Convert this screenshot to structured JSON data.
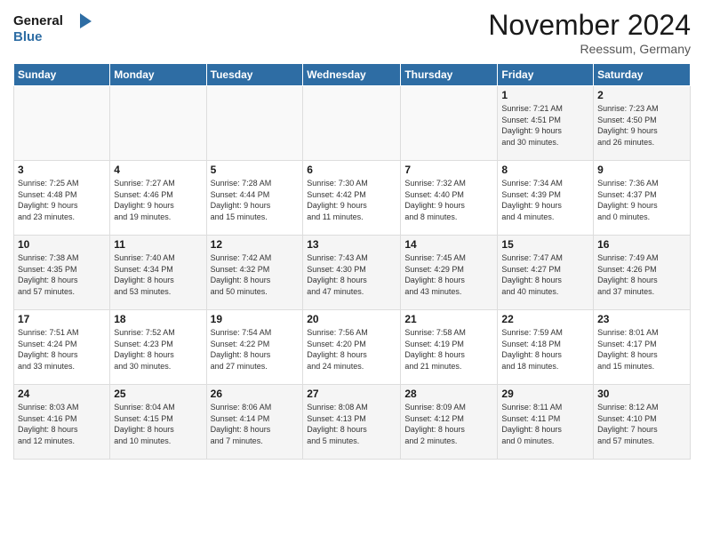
{
  "logo": {
    "line1": "General",
    "line2": "Blue"
  },
  "title": "November 2024",
  "location": "Reessum, Germany",
  "headers": [
    "Sunday",
    "Monday",
    "Tuesday",
    "Wednesday",
    "Thursday",
    "Friday",
    "Saturday"
  ],
  "weeks": [
    [
      {
        "day": "",
        "info": ""
      },
      {
        "day": "",
        "info": ""
      },
      {
        "day": "",
        "info": ""
      },
      {
        "day": "",
        "info": ""
      },
      {
        "day": "",
        "info": ""
      },
      {
        "day": "1",
        "info": "Sunrise: 7:21 AM\nSunset: 4:51 PM\nDaylight: 9 hours\nand 30 minutes."
      },
      {
        "day": "2",
        "info": "Sunrise: 7:23 AM\nSunset: 4:50 PM\nDaylight: 9 hours\nand 26 minutes."
      }
    ],
    [
      {
        "day": "3",
        "info": "Sunrise: 7:25 AM\nSunset: 4:48 PM\nDaylight: 9 hours\nand 23 minutes."
      },
      {
        "day": "4",
        "info": "Sunrise: 7:27 AM\nSunset: 4:46 PM\nDaylight: 9 hours\nand 19 minutes."
      },
      {
        "day": "5",
        "info": "Sunrise: 7:28 AM\nSunset: 4:44 PM\nDaylight: 9 hours\nand 15 minutes."
      },
      {
        "day": "6",
        "info": "Sunrise: 7:30 AM\nSunset: 4:42 PM\nDaylight: 9 hours\nand 11 minutes."
      },
      {
        "day": "7",
        "info": "Sunrise: 7:32 AM\nSunset: 4:40 PM\nDaylight: 9 hours\nand 8 minutes."
      },
      {
        "day": "8",
        "info": "Sunrise: 7:34 AM\nSunset: 4:39 PM\nDaylight: 9 hours\nand 4 minutes."
      },
      {
        "day": "9",
        "info": "Sunrise: 7:36 AM\nSunset: 4:37 PM\nDaylight: 9 hours\nand 0 minutes."
      }
    ],
    [
      {
        "day": "10",
        "info": "Sunrise: 7:38 AM\nSunset: 4:35 PM\nDaylight: 8 hours\nand 57 minutes."
      },
      {
        "day": "11",
        "info": "Sunrise: 7:40 AM\nSunset: 4:34 PM\nDaylight: 8 hours\nand 53 minutes."
      },
      {
        "day": "12",
        "info": "Sunrise: 7:42 AM\nSunset: 4:32 PM\nDaylight: 8 hours\nand 50 minutes."
      },
      {
        "day": "13",
        "info": "Sunrise: 7:43 AM\nSunset: 4:30 PM\nDaylight: 8 hours\nand 47 minutes."
      },
      {
        "day": "14",
        "info": "Sunrise: 7:45 AM\nSunset: 4:29 PM\nDaylight: 8 hours\nand 43 minutes."
      },
      {
        "day": "15",
        "info": "Sunrise: 7:47 AM\nSunset: 4:27 PM\nDaylight: 8 hours\nand 40 minutes."
      },
      {
        "day": "16",
        "info": "Sunrise: 7:49 AM\nSunset: 4:26 PM\nDaylight: 8 hours\nand 37 minutes."
      }
    ],
    [
      {
        "day": "17",
        "info": "Sunrise: 7:51 AM\nSunset: 4:24 PM\nDaylight: 8 hours\nand 33 minutes."
      },
      {
        "day": "18",
        "info": "Sunrise: 7:52 AM\nSunset: 4:23 PM\nDaylight: 8 hours\nand 30 minutes."
      },
      {
        "day": "19",
        "info": "Sunrise: 7:54 AM\nSunset: 4:22 PM\nDaylight: 8 hours\nand 27 minutes."
      },
      {
        "day": "20",
        "info": "Sunrise: 7:56 AM\nSunset: 4:20 PM\nDaylight: 8 hours\nand 24 minutes."
      },
      {
        "day": "21",
        "info": "Sunrise: 7:58 AM\nSunset: 4:19 PM\nDaylight: 8 hours\nand 21 minutes."
      },
      {
        "day": "22",
        "info": "Sunrise: 7:59 AM\nSunset: 4:18 PM\nDaylight: 8 hours\nand 18 minutes."
      },
      {
        "day": "23",
        "info": "Sunrise: 8:01 AM\nSunset: 4:17 PM\nDaylight: 8 hours\nand 15 minutes."
      }
    ],
    [
      {
        "day": "24",
        "info": "Sunrise: 8:03 AM\nSunset: 4:16 PM\nDaylight: 8 hours\nand 12 minutes."
      },
      {
        "day": "25",
        "info": "Sunrise: 8:04 AM\nSunset: 4:15 PM\nDaylight: 8 hours\nand 10 minutes."
      },
      {
        "day": "26",
        "info": "Sunrise: 8:06 AM\nSunset: 4:14 PM\nDaylight: 8 hours\nand 7 minutes."
      },
      {
        "day": "27",
        "info": "Sunrise: 8:08 AM\nSunset: 4:13 PM\nDaylight: 8 hours\nand 5 minutes."
      },
      {
        "day": "28",
        "info": "Sunrise: 8:09 AM\nSunset: 4:12 PM\nDaylight: 8 hours\nand 2 minutes."
      },
      {
        "day": "29",
        "info": "Sunrise: 8:11 AM\nSunset: 4:11 PM\nDaylight: 8 hours\nand 0 minutes."
      },
      {
        "day": "30",
        "info": "Sunrise: 8:12 AM\nSunset: 4:10 PM\nDaylight: 7 hours\nand 57 minutes."
      }
    ]
  ]
}
